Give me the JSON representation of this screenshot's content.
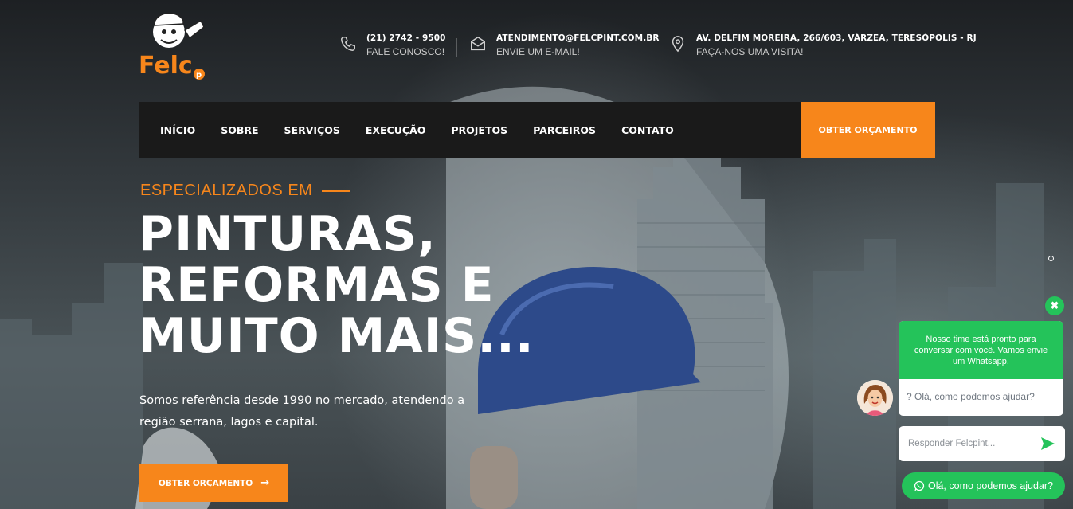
{
  "brand": {
    "logo_text": "Felc",
    "accent": "#f7861b"
  },
  "contacts": [
    {
      "icon": "phone-icon",
      "line1": "(21) 2742 - 9500",
      "line2": "FALE CONOSCO!"
    },
    {
      "icon": "envelope-icon",
      "line1": "ATENDIMENTO@FELCPINT.COM.BR",
      "line2": "ENVIE UM E-MAIL!"
    },
    {
      "icon": "map-pin-icon",
      "line1": "AV. DELFIM MOREIRA, 266/603, VÁRZEA, TERESÓPOLIS - RJ",
      "line2": "FAÇA-NOS UMA VISITA!"
    }
  ],
  "nav": {
    "items": [
      "INÍCIO",
      "SOBRE",
      "SERVIÇOS",
      "EXECUÇÃO",
      "PROJETOS",
      "PARCEIROS",
      "CONTATO"
    ],
    "cta": "OBTER ORÇAMENTO"
  },
  "hero": {
    "eyebrow": "ESPECIALIZADOS EM",
    "headline": [
      "PINTURAS,",
      "REFORMAS E",
      "MUITO MAIS..."
    ],
    "description": "Somos referência desde 1990 no mercado, atendendo a região serrana, lagos e capital.",
    "button": "OBTER ORÇAMENTO",
    "button_arrow": "→"
  },
  "chat": {
    "close_glyph": "✖",
    "greeting": "Nosso time está pronto para conversar com você. Vamos envie um Whatsapp.",
    "message": "? Olá, como podemos ajudar?",
    "input_placeholder": "Responder Felcpint...",
    "whatsapp_button": "Olá, como podemos ajudar?",
    "green": "#24c35a"
  }
}
